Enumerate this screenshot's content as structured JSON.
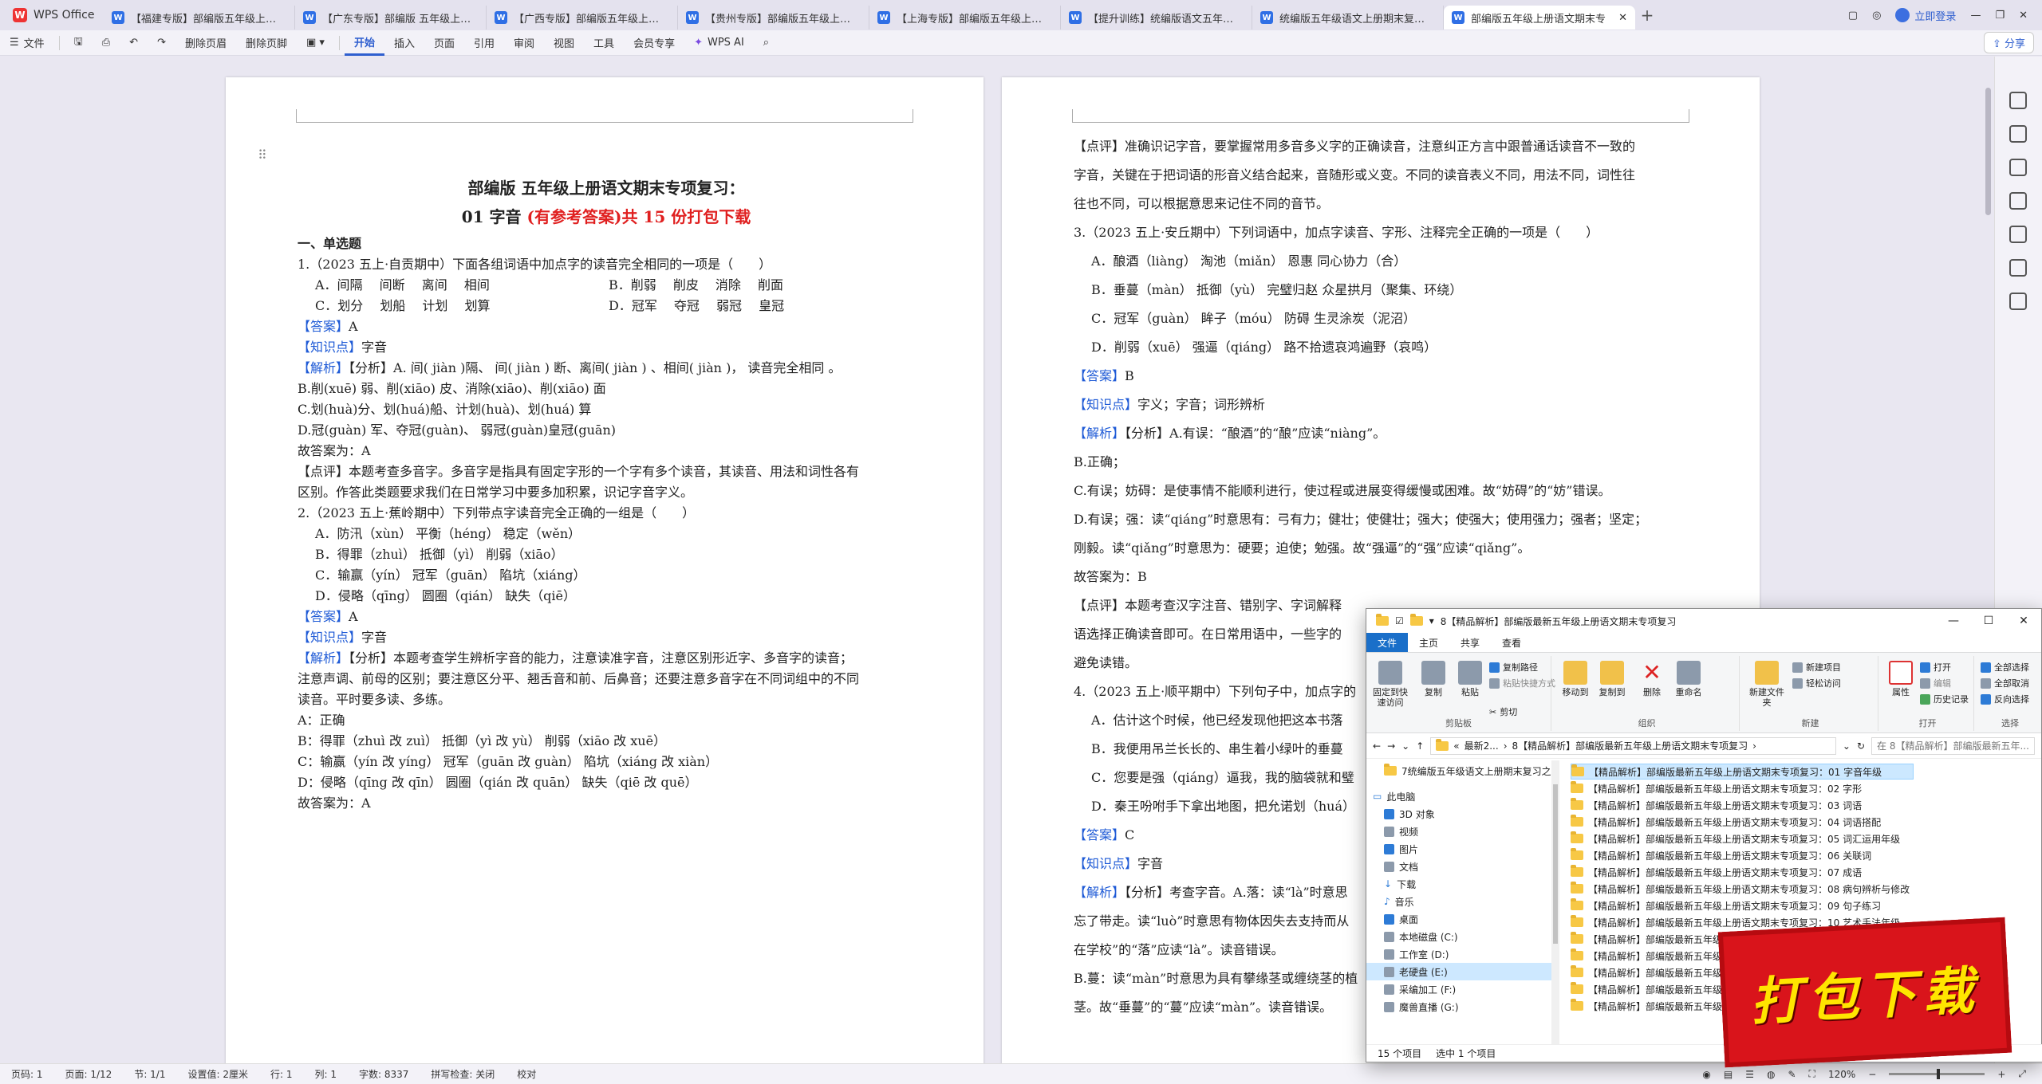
{
  "app": {
    "name": "WPS Office"
  },
  "tabs": [
    "【福建专版】部编版五年级上册--积累",
    "【广东专版】部编版 五年级上册--积",
    "【广西专版】部编版五年级上册--积",
    "【贵州专版】部编版五年级上册--积",
    "【上海专版】部编版五年级上册--积",
    "【提升训练】统编版语文五年级上册",
    "统编版五年级语文上册期末复习之口",
    "部编版五年级上册语文期末专"
  ],
  "topbar": {
    "login": "立即登录"
  },
  "ribbon": {
    "file": "文件",
    "delete_page": "删除页眉",
    "delete_footer": "删除页脚",
    "tabs": [
      "开始",
      "插入",
      "页面",
      "引用",
      "审阅",
      "视图",
      "工具",
      "会员专享"
    ],
    "wps_ai": "WPS AI",
    "share": "分享"
  },
  "left_page": {
    "title1": "部编版 五年级上册语文期末专项复习：",
    "title2_black": "01 字音",
    "title2_red": "(有参考答案)共 15 份打包下载",
    "section": "一、单选题",
    "q1": "1.（2023 五上·自贡期中）下面各组词语中加点字的读音完全相同的一项是（　　）",
    "q1_opts": {
      "A": "A．间隔　 间断　 离间　 相间",
      "B": "B．削弱　 削皮　 消除　 削面",
      "C": "C．划分　 划船　 计划　 划算",
      "D": "D．冠军　 夺冠　 弱冠　 皇冠"
    },
    "ans_label": "【答案】",
    "q1_answer": "A",
    "kp_label": "【知识点】",
    "kp_value": "字音",
    "analysis_label": "【解析】",
    "q1_analysis": [
      "【分析】A. 间( jiàn )隔、 间( jiàn ) 断、离间( jiàn ) 、相间( jiàn )，  读音完全相同  。",
      "B.削(xuē) 弱、削(xiāo) 皮、消除(xiāo)、削(xiāo) 面",
      "C.划(huà)分、划(huá)船、计划(huà)、划(huá) 算",
      "D.冠(guàn) 军、夺冠(guàn)、  弱冠(guàn)皇冠(guān)",
      "故答案为：A"
    ],
    "q1_comment": [
      "【点评】本题考查多音字。多音字是指具有固定字形的一个字有多个读音，其读音、用法和词性各有",
      "区别。作答此类题要求我们在日常学习中要多加积累，识记字音字义。"
    ],
    "q2": "2.（2023 五上·蕉岭期中）下列带点字读音完全正确的一组是（　　）",
    "q2_opts": [
      "A．防汛（xùn） 平衡（héng） 稳定（wěn）",
      "B．得罪（zhuì） 抵御（yì） 削弱（xiāo）",
      "C．输赢（yín） 冠军（guān） 陷坑（xiáng）",
      "D．侵略（qīng） 圆圈（qián） 缺失（qiē）"
    ],
    "q2_answer": "A",
    "q2_analysis": [
      "【分析】本题考查学生辨析字音的能力，注意读准字音，注意区别形近字、多音字的读音；",
      "注意声调、前母的区别；要注意区分平、翘舌音和前、后鼻音；还要注意多音字在不同词组中的不同",
      "读音。平时要多读、多练。",
      "A：正确",
      "B：得罪（zhuì 改 zuì） 抵御（yì 改 yù） 削弱（xiāo 改 xuē）",
      "C：输赢（yín 改 yíng） 冠军（guān 改 guàn） 陷坑（xiáng 改 xiàn）",
      "D：侵略（qīng 改 qīn） 圆圈（qián 改 quān） 缺失（qiē 改 quē）",
      "故答案为：A"
    ]
  },
  "right_page": {
    "comment_top": [
      "【点评】准确识记字音，要掌握常用多音多义字的正确读音，注意纠正方言中跟普通话读音不一致的",
      "字音，关键在于把词语的形音义结合起来，音随形或义变。不同的读音表义不同，用法不同，词性往",
      "往也不同，可以根据意思来记住不同的音节。"
    ],
    "q3": "3.（2023 五上·安丘期中）下列词语中，加点字读音、字形、注释完全正确的一项是（　　）",
    "q3_opts": [
      "A．酿酒（liàng） 淘池（miǎn） 恩惠  同心协力（合）",
      "B．垂蔓（màn） 抵御（yù） 完璧归赵  众星拱月（聚集、环绕）",
      "C．冠军（guàn） 眸子（móu） 防碍  生灵涂炭（泥沼）",
      "D．削弱（xuē） 强逼（qiáng） 路不拾遗哀鸿遍野（哀鸣）"
    ],
    "q3_answer": "B",
    "q3_kp": "字义；字音；词形辨析",
    "q3_analysis": [
      "【分析】A.有误：“酿酒”的“酿”应读“niàng”。",
      "B.正确；",
      "C.有误；妨碍：是使事情不能顺利进行，使过程或进展变得缓慢或困难。故“妨碍”的“妨”错误。",
      "D.有误；强：读“qiáng”时意思有：弓有力；健壮；使健壮；强大；使强大；使用强力；强者；坚定；",
      "刚毅。读“qiǎng”时意思为：硬要；迫使；勉强。故“强逼”的“强”应读“qiǎng”。",
      "故答案为：B"
    ],
    "q3_comment": [
      "【点评】本题考查汉字注音、错别字、字词解释",
      "语选择正确读音即可。在日常用语中，一些字的",
      "避免读错。"
    ],
    "q4": "4.（2023 五上·顺平期中）下列句子中，加点字的",
    "q4_opts": [
      "A．估计这个时候，他已经发现他把这本书落",
      "B．我便用吊兰长长的、串生着小绿叶的垂蔓",
      "C．您要是强（qiáng）逼我，我的脑袋就和璧",
      "D．秦王吩咐手下拿出地图，把允诺划（huá）"
    ],
    "q4_answer": "C",
    "q4_kp": "字音",
    "q4_analysis": [
      "【分析】考查字音。A.落：读“là”时意思",
      "忘了带走。读“luò”时意思有物体因失去支持而从",
      "在学校”的“落”应读“là”。读音错误。",
      "B.蔓：读“màn”时意思为具有攀缘茎或缠绕茎的植",
      "茎。故“垂蔓”的“蔓”应读“màn”。读音错误。"
    ]
  },
  "explorer": {
    "title": "8【精品解析】部编版最新五年级上册语文期末专项复习",
    "tabs": [
      "文件",
      "主页",
      "共享",
      "查看"
    ],
    "ribbon": {
      "pin": "固定到快速访问",
      "copy": "复制",
      "paste": "粘贴",
      "copy_path": "复制路径",
      "paste_shortcut": "粘贴快捷方式",
      "cut": "剪切",
      "group_clipboard": "剪贴板",
      "move_to": "移动到",
      "copy_to": "复制到",
      "delete": "删除",
      "rename": "重命名",
      "group_organize": "组织",
      "new_folder": "新建文件夹",
      "new_item": "新建项目",
      "easy_access": "轻松访问",
      "group_new": "新建",
      "properties": "属性",
      "open": "打开",
      "edit": "编辑",
      "history": "历史记录",
      "group_open": "打开",
      "select_all": "全部选择",
      "select_none": "全部取消",
      "invert": "反向选择",
      "group_select": "选择"
    },
    "address": [
      "最新2...",
      "8【精品解析】部编版最新五年级上册语文期末专项复习"
    ],
    "search_placeholder": "在 8【精品解析】部编版最新五年...",
    "nav": [
      "7统编版五年级语文上册期末复习之",
      "此电脑",
      "3D 对象",
      "视频",
      "图片",
      "文档",
      "下载",
      "音乐",
      "桌面",
      "本地磁盘 (C:)",
      "工作室 (D:)",
      "老硬盘 (E:)",
      "采编加工 (F:)",
      "魔兽直播 (G:)"
    ],
    "files": [
      "【精品解析】部编版最新五年级上册语文期末专项复习：01 字音年级",
      "【精品解析】部编版最新五年级上册语文期末专项复习：02 字形",
      "【精品解析】部编版最新五年级上册语文期末专项复习：03 词语",
      "【精品解析】部编版最新五年级上册语文期末专项复习：04 词语搭配",
      "【精品解析】部编版最新五年级上册语文期末专项复习：05 词汇运用年级",
      "【精品解析】部编版最新五年级上册语文期末专项复习：06 关联词",
      "【精品解析】部编版最新五年级上册语文期末专项复习：07 成语",
      "【精品解析】部编版最新五年级上册语文期末专项复习：08 病句辨析与修改",
      "【精品解析】部编版最新五年级上册语文期末专项复习：09 句子练习",
      "【精品解析】部编版最新五年级上册语文期末专项复习：10 艺术手法年级",
      "【精品解析】部编版最新五年级上册语文期末专",
      "【精品解析】部编版最新五年级上册语文期末专",
      "【精品解析】部编版最新五年级上册语文期末专",
      "【精品解析】部编版最新五年级上册语文期末专",
      "【精品解析】部编版最新五年级上册语文期末专"
    ],
    "status_count": "15 个项目",
    "status_selected": "选中 1 个项目"
  },
  "promo": "打包下载",
  "statusbar": {
    "page_num": "页码: 1",
    "pages": "页面: 1/12",
    "section": "节: 1/1",
    "setting": "设置值: 2厘米",
    "row": "行: 1",
    "col": "列: 1",
    "words": "字数: 8337",
    "spell": "拼写检查: 关闭",
    "proof": "校对",
    "zoom": "120%"
  }
}
